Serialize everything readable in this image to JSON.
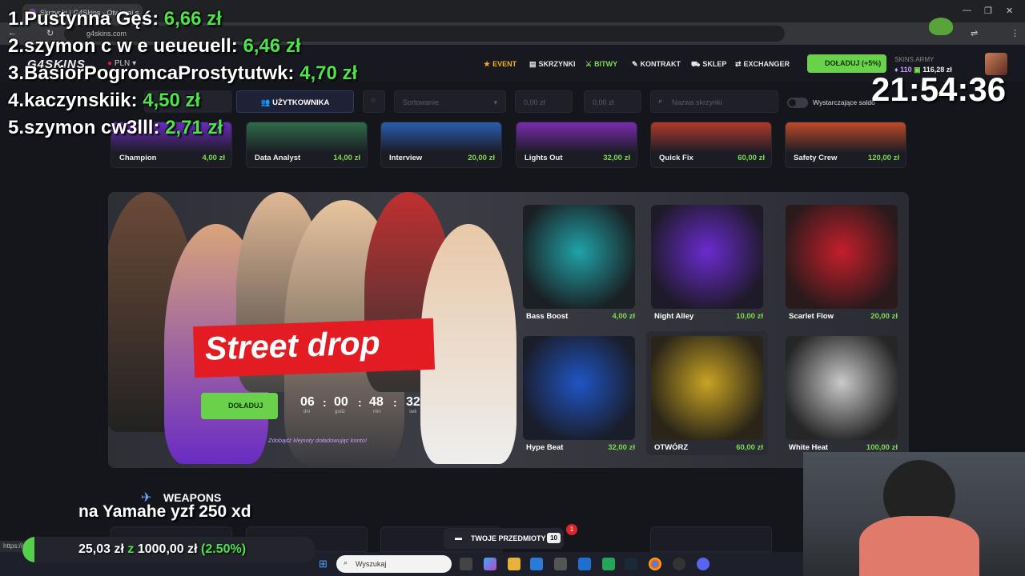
{
  "browser": {
    "tab_title": "Skrzynki | G4Skins - Otwieraj s",
    "url": "g4skins.com",
    "status_url": "https://g4skins.com/case/1...."
  },
  "nav": {
    "logo": "G4SKINS",
    "currency": "PLN",
    "items": [
      {
        "label": "EVENT",
        "icon": "star-icon",
        "color": "#f2b01e"
      },
      {
        "label": "SKRZYNKI",
        "icon": "box-icon",
        "color": "#e6e6ea"
      },
      {
        "label": "BITWY",
        "icon": "battle-icon",
        "color": "#7edb52"
      },
      {
        "label": "KONTRAKT",
        "icon": "pen-icon",
        "color": "#e6e6ea"
      },
      {
        "label": "SKLEP",
        "icon": "cart-icon",
        "color": "#e6e6ea"
      },
      {
        "label": "EXCHANGER",
        "icon": "exchange-icon",
        "color": "#e6e6ea"
      }
    ],
    "topup_label": "DOŁADUJ (+5%)",
    "account_name": "SKINS.ARMY",
    "gems": "110",
    "balance": "116,28 zł"
  },
  "filters": {
    "users_tab": "UŻYTKOWNIKA",
    "sort_placeholder": "Sortowanie",
    "min_price": "0,00 zł",
    "max_price": "0,00 zł",
    "search_placeholder": "Nazwa skrzynki",
    "toggle_label": "Wystarczające saldo"
  },
  "top_cases": [
    {
      "name": "Champion",
      "price": "4,00 zł",
      "color": "#6b2bbf"
    },
    {
      "name": "Data Analyst",
      "price": "14,00 zł",
      "color": "#2e6b4a"
    },
    {
      "name": "Interview",
      "price": "20,00 zł",
      "color": "#2a5db0"
    },
    {
      "name": "Lights Out",
      "price": "32,00 zł",
      "color": "#7a2bb0"
    },
    {
      "name": "Quick Fix",
      "price": "60,00 zł",
      "color": "#b03a2a"
    },
    {
      "name": "Safety Crew",
      "price": "120,00 zł",
      "color": "#c04a28"
    }
  ],
  "banner": {
    "title": "Street drop",
    "button_label": "DOŁADUJ",
    "countdown": [
      {
        "value": "06",
        "label": "dni"
      },
      {
        "value": "00",
        "label": "godz"
      },
      {
        "value": "48",
        "label": "min"
      },
      {
        "value": "32",
        "label": "sek"
      }
    ],
    "gems_text": "Zdobądź klejnoty doładowując konto!",
    "cases": [
      {
        "name": "Bass Boost",
        "price": "4,00 zł",
        "color": "#1fa3a8"
      },
      {
        "name": "Night Alley",
        "price": "10,00 zł",
        "color": "#6a2bd0"
      },
      {
        "name": "Scarlet Flow",
        "price": "20,00 zł",
        "color": "#c41f2a"
      },
      {
        "name": "Hype Beat",
        "price": "32,00 zł",
        "color": "#1f55c4"
      },
      {
        "name": "OTWÓRZ",
        "price": "60,00 zł",
        "color": "#c9a323"
      },
      {
        "name": "White Heat",
        "price": "100,00 zł",
        "color": "#c9c9c9"
      }
    ]
  },
  "section": {
    "title": "WEAPONS"
  },
  "your_items": {
    "label": "TWOJE PRZEDMIOTY",
    "count": "10",
    "notification": "1"
  },
  "taskbar": {
    "search_placeholder": "Wyszukaj"
  },
  "overlay": {
    "leaderboard": [
      {
        "rank": "1.",
        "name": "Pustynna Gęś:",
        "amount": "6,66 zł"
      },
      {
        "rank": "2.",
        "name": "szymon c w e ueueuell:",
        "amount": "6,46 zł"
      },
      {
        "rank": "3.",
        "name": "BasiorPogromcaProstytutwk:",
        "amount": "4,70 zł"
      },
      {
        "rank": "4.",
        "name": "kaczynskiik:",
        "amount": "4,50 zł"
      },
      {
        "rank": "5.",
        "name": "szymon cw3lll:",
        "amount": "2,71 zł"
      }
    ],
    "clock": "21:54:36",
    "caption": "na Yamahe yzf 250 xd",
    "goal_current": "25,03 zł",
    "goal_sep": "z",
    "goal_target": "1000,00 zł",
    "goal_percent": "(2.50%)",
    "goal_fraction": 0.025
  }
}
